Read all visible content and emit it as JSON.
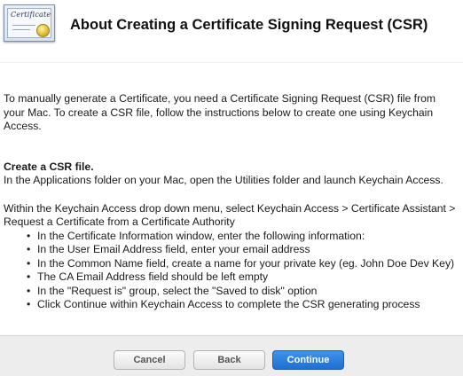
{
  "header": {
    "icon": "certificate-icon",
    "icon_text": "Certificate",
    "title": "About Creating a Certificate Signing Request (CSR)"
  },
  "content": {
    "intro": "To manually generate a Certificate, you need a Certificate Signing Request (CSR) file from your Mac. To create a CSR file, follow the instructions below to create one using Keychain Access.",
    "section_heading": "Create a CSR file.",
    "apps_instruction": "In the Applications folder on your Mac, open the Utilities folder and launch Keychain Access.",
    "menu_instruction": "Within the Keychain Access drop down menu, select Keychain Access > Certificate Assistant > Request a Certificate from a Certificate Authority",
    "bullets": [
      "In the Certificate Information window, enter the following information:",
      "In the User Email Address field, enter your email address",
      "In the Common Name field, create a name for your private key (eg. John Doe Dev Key)",
      "The CA Email Address field should be left empty",
      "In the \"Request is\" group, select the \"Saved to disk\" option",
      "Click Continue within Keychain Access to complete the CSR generating process"
    ],
    "bullet_glyph": "•"
  },
  "footer": {
    "cancel_label": "Cancel",
    "back_label": "Back",
    "continue_label": "Continue"
  },
  "colors": {
    "primary_button": "#2a7ee0",
    "footer_bg": "#ededed"
  }
}
